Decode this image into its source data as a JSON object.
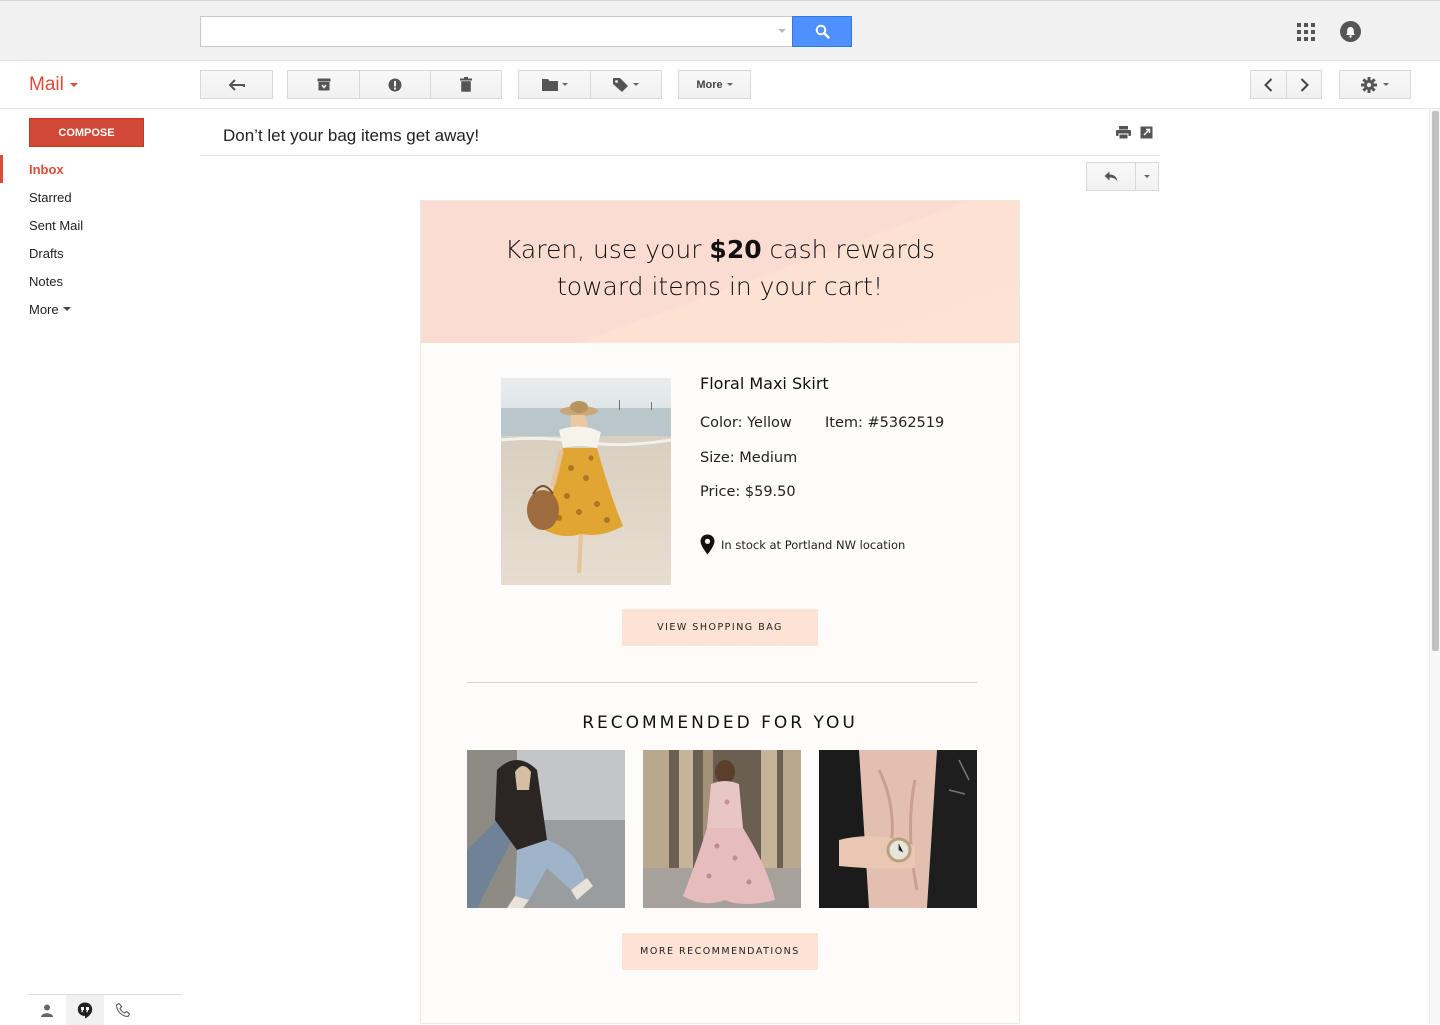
{
  "header": {
    "search": {
      "value": "",
      "placeholder": ""
    }
  },
  "toolbar": {
    "app_label": "Mail",
    "more_label": "More"
  },
  "sidebar": {
    "compose_label": "COMPOSE",
    "items": [
      {
        "label": "Inbox",
        "active": true
      },
      {
        "label": "Starred"
      },
      {
        "label": "Sent Mail"
      },
      {
        "label": "Drafts"
      },
      {
        "label": "Notes"
      },
      {
        "label": "More"
      }
    ]
  },
  "message": {
    "subject": "Don’t let your bag items get away!"
  },
  "email": {
    "hero_line1_pre": "Karen, use your ",
    "hero_amount": "$20",
    "hero_line1_post": " cash rewards",
    "hero_line2": "toward items in your cart!",
    "product": {
      "name": "Floral Maxi Skirt",
      "color": "Color: Yellow",
      "item": "Item: #5362519",
      "size": "Size: Medium",
      "price": "Price: $59.50",
      "stock": "In stock at Portland NW location"
    },
    "view_bag_label": "VIEW SHOPPING BAG",
    "recommended_title": "RECOMMENDED FOR YOU",
    "more_recs_label": "MORE RECOMMENDATIONS"
  },
  "colors": {
    "accent": "#dd4b39",
    "search_button": "#4d90fe",
    "cta_bg": "#fde2d6"
  },
  "icons": [
    "search-icon",
    "apps-icon",
    "notifications-icon",
    "back-arrow-icon",
    "archive-icon",
    "spam-icon",
    "trash-icon",
    "folder-icon",
    "label-icon",
    "chevron-left-icon",
    "chevron-right-icon",
    "gear-icon",
    "print-icon",
    "new-window-icon",
    "reply-icon",
    "location-pin-icon",
    "contacts-icon",
    "hangouts-icon",
    "phone-icon"
  ]
}
